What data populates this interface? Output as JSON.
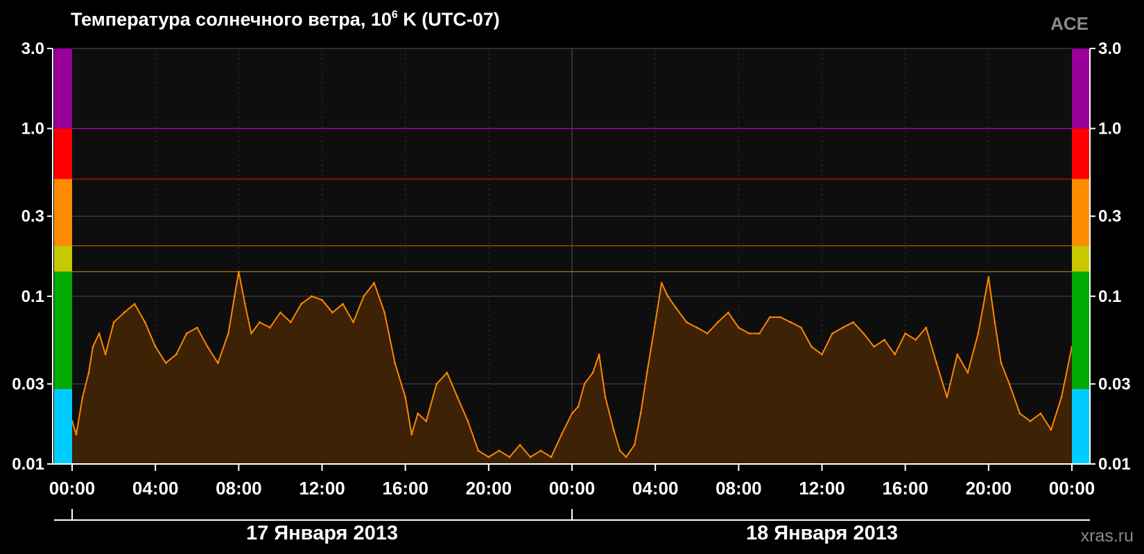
{
  "header": {
    "title_main": "Температура солнечного ветра, 10",
    "title_sup": "6",
    "title_tail": " K (UTC-07)",
    "brand": "ACE"
  },
  "footer": {
    "site": "xras.ru"
  },
  "chart_data": {
    "type": "area",
    "title": "Температура солнечного ветра, 10^6 K (UTC-07)",
    "ylabel": "",
    "xlabel": "",
    "y_scale": "log",
    "ylim": [
      0.01,
      3.0
    ],
    "xlim_hours": [
      0,
      48
    ],
    "y_ticks": [
      {
        "value": 3.0,
        "label": "3.0"
      },
      {
        "value": 1.0,
        "label": "1.0"
      },
      {
        "value": 0.3,
        "label": "0.3"
      },
      {
        "value": 0.1,
        "label": "0.1"
      },
      {
        "value": 0.03,
        "label": "0.03"
      },
      {
        "value": 0.01,
        "label": "0.01"
      }
    ],
    "x_ticks": [
      {
        "hour": 0,
        "label": "00:00"
      },
      {
        "hour": 4,
        "label": "04:00"
      },
      {
        "hour": 8,
        "label": "08:00"
      },
      {
        "hour": 12,
        "label": "12:00"
      },
      {
        "hour": 16,
        "label": "16:00"
      },
      {
        "hour": 20,
        "label": "20:00"
      },
      {
        "hour": 24,
        "label": "00:00"
      },
      {
        "hour": 28,
        "label": "04:00"
      },
      {
        "hour": 32,
        "label": "08:00"
      },
      {
        "hour": 36,
        "label": "12:00"
      },
      {
        "hour": 40,
        "label": "16:00"
      },
      {
        "hour": 44,
        "label": "20:00"
      },
      {
        "hour": 48,
        "label": "00:00"
      }
    ],
    "dates": [
      {
        "label": "17 Января 2013",
        "start_hour": 0,
        "end_hour": 24
      },
      {
        "label": "18 Января 2013",
        "start_hour": 24,
        "end_hour": 48
      }
    ],
    "thresholds": [
      {
        "value": 1.0,
        "color": "#b000b0"
      },
      {
        "value": 0.5,
        "color": "#b02000"
      },
      {
        "value": 0.2,
        "color": "#b05800"
      },
      {
        "value": 0.14,
        "color": "#a08000"
      }
    ],
    "level_bands": [
      {
        "from": 1.0,
        "to": 3.0,
        "color": "#990099"
      },
      {
        "from": 0.5,
        "to": 1.0,
        "color": "#ff0000"
      },
      {
        "from": 0.2,
        "to": 0.5,
        "color": "#ff8c00"
      },
      {
        "from": 0.14,
        "to": 0.2,
        "color": "#c8c800"
      },
      {
        "from": 0.028,
        "to": 0.14,
        "color": "#00aa00"
      },
      {
        "from": 0.01,
        "to": 0.028,
        "color": "#00ccff"
      }
    ],
    "colors": {
      "line": "#ff8800",
      "fill": "#3d2205",
      "plot_bg": "#0e0e0e",
      "grid": "#444444"
    },
    "grid": true,
    "series": [
      {
        "x_hours": [
          0.0,
          0.2,
          0.5,
          0.8,
          1.0,
          1.3,
          1.6,
          2.0,
          2.5,
          3.0,
          3.5,
          4.0,
          4.5,
          5.0,
          5.5,
          6.0,
          6.5,
          7.0,
          7.5,
          7.8,
          8.0,
          8.3,
          8.6,
          9.0,
          9.5,
          10.0,
          10.5,
          11.0,
          11.5,
          12.0,
          12.5,
          13.0,
          13.5,
          14.0,
          14.5,
          15.0,
          15.5,
          16.0,
          16.3,
          16.6,
          17.0,
          17.5,
          18.0,
          18.5,
          19.0,
          19.5,
          20.0,
          20.5,
          21.0,
          21.5,
          22.0,
          22.5,
          23.0,
          23.5,
          24.0,
          24.3,
          24.6,
          25.0,
          25.3,
          25.6,
          26.0,
          26.3,
          26.6,
          27.0,
          27.3,
          27.6,
          28.0,
          28.3,
          28.6,
          29.0,
          29.5,
          30.0,
          30.5,
          31.0,
          31.5,
          32.0,
          32.5,
          33.0,
          33.5,
          34.0,
          34.5,
          35.0,
          35.5,
          36.0,
          36.5,
          37.0,
          37.5,
          38.0,
          38.5,
          39.0,
          39.5,
          40.0,
          40.5,
          41.0,
          41.5,
          42.0,
          42.5,
          43.0,
          43.5,
          44.0,
          44.3,
          44.6,
          45.0,
          45.5,
          46.0,
          46.5,
          47.0,
          47.5,
          48.0
        ],
        "values": [
          0.018,
          0.015,
          0.025,
          0.035,
          0.05,
          0.06,
          0.045,
          0.07,
          0.08,
          0.09,
          0.07,
          0.05,
          0.04,
          0.045,
          0.06,
          0.065,
          0.05,
          0.04,
          0.06,
          0.1,
          0.14,
          0.09,
          0.06,
          0.07,
          0.065,
          0.08,
          0.07,
          0.09,
          0.1,
          0.095,
          0.08,
          0.09,
          0.07,
          0.1,
          0.12,
          0.08,
          0.04,
          0.025,
          0.015,
          0.02,
          0.018,
          0.03,
          0.035,
          0.025,
          0.018,
          0.012,
          0.011,
          0.012,
          0.011,
          0.013,
          0.011,
          0.012,
          0.011,
          0.015,
          0.02,
          0.022,
          0.03,
          0.035,
          0.045,
          0.025,
          0.016,
          0.012,
          0.011,
          0.013,
          0.02,
          0.035,
          0.07,
          0.12,
          0.1,
          0.085,
          0.07,
          0.065,
          0.06,
          0.07,
          0.08,
          0.065,
          0.06,
          0.06,
          0.075,
          0.075,
          0.07,
          0.065,
          0.05,
          0.045,
          0.06,
          0.065,
          0.07,
          0.06,
          0.05,
          0.055,
          0.045,
          0.06,
          0.055,
          0.065,
          0.04,
          0.025,
          0.045,
          0.035,
          0.06,
          0.13,
          0.07,
          0.04,
          0.03,
          0.02,
          0.018,
          0.02,
          0.016,
          0.025,
          0.05
        ]
      }
    ]
  }
}
